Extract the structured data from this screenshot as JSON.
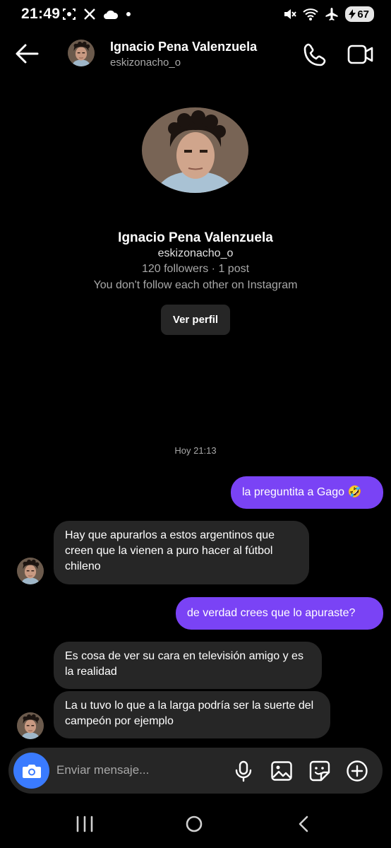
{
  "status_bar": {
    "time": "21:49",
    "battery": "67"
  },
  "header": {
    "name": "Ignacio Pena Valenzuela",
    "username": "eskizonacho_o"
  },
  "profile": {
    "name": "Ignacio Pena Valenzuela",
    "username": "eskizonacho_o",
    "stats": "120 followers · 1 post",
    "follow_status": "You don't follow each other on Instagram",
    "view_profile_label": "Ver perfil"
  },
  "thread": {
    "timestamp": "Hoy 21:13",
    "messages": [
      {
        "direction": "out",
        "text": "la preguntita a Gago 🤣"
      },
      {
        "direction": "in",
        "text": "Hay que apurarlos a estos argentinos que creen que la vienen a puro hacer al fútbol chileno"
      },
      {
        "direction": "out",
        "text": "de verdad crees que lo apuraste?"
      },
      {
        "direction": "in",
        "text": "Es cosa de ver su cara en televisión amigo y es la realidad"
      },
      {
        "direction": "in",
        "text": "La u tuvo lo que a la larga podría ser la suerte del campeón por ejemplo"
      }
    ]
  },
  "composer": {
    "placeholder": "Enviar mensaje..."
  },
  "colors": {
    "background": "#000000",
    "outgoing_bubble": "#7a43f5",
    "incoming_bubble": "#262626",
    "camera_button": "#3a7bff",
    "secondary_text": "#a8a8a8"
  },
  "icons": {
    "header": [
      "back-arrow-icon",
      "phone-icon",
      "video-camera-icon"
    ],
    "composer": [
      "camera-icon",
      "microphone-icon",
      "gallery-icon",
      "sticker-icon",
      "plus-circle-icon"
    ],
    "nav": [
      "recent-apps-icon",
      "home-icon",
      "back-icon"
    ]
  }
}
